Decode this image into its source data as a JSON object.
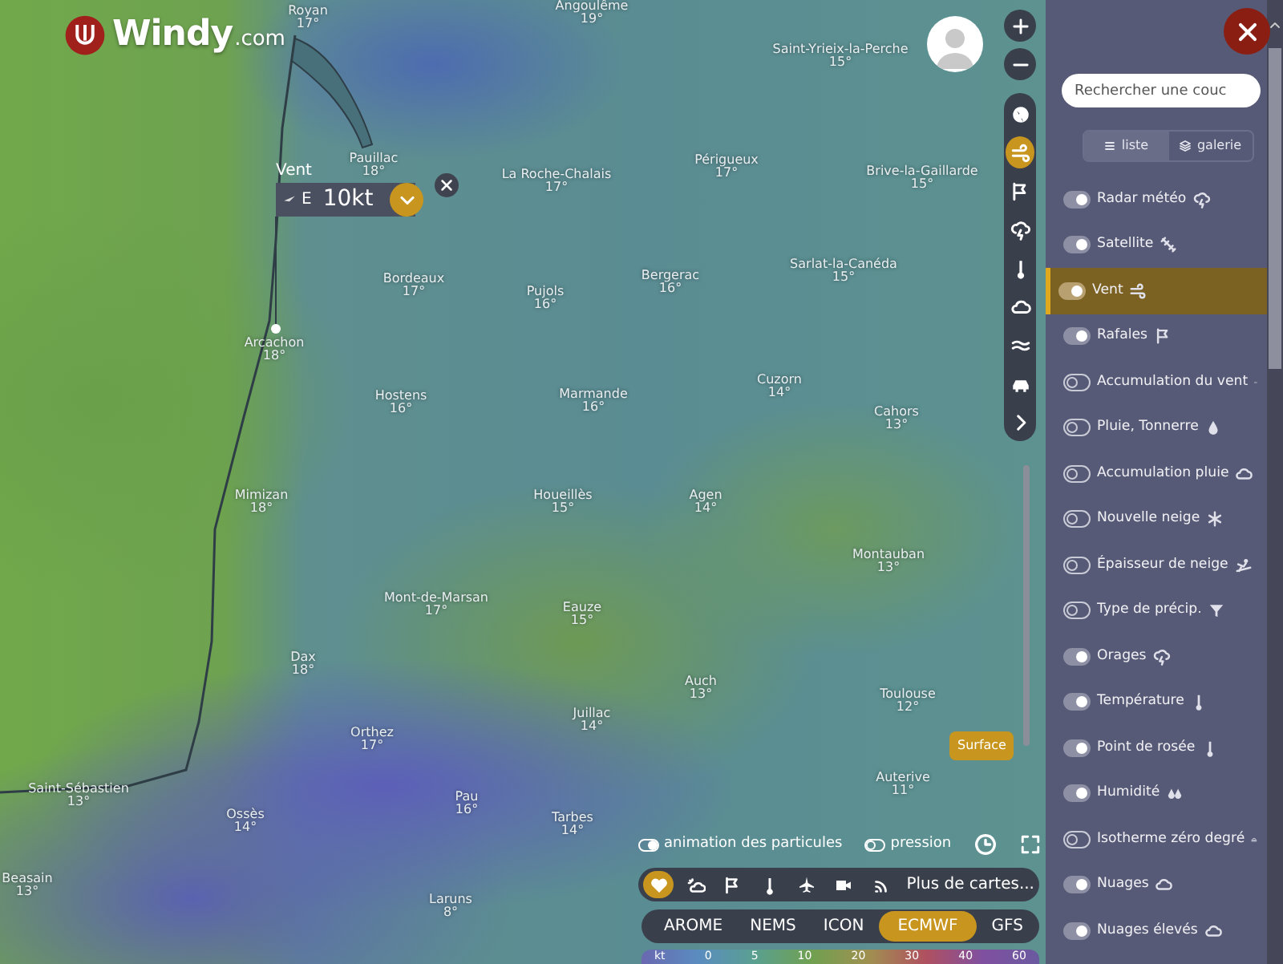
{
  "logo": {
    "name": "Windy",
    "suffix": ".com"
  },
  "map": {
    "cities": [
      {
        "name": "Royan",
        "temp": "17°"
      },
      {
        "name": "Angoulême",
        "temp": "19°"
      },
      {
        "name": "Saint-Yrieix-la-Perche",
        "temp": "15°"
      },
      {
        "name": "Pauillac",
        "temp": "18°"
      },
      {
        "name": "La Roche-Chalais",
        "temp": "17°"
      },
      {
        "name": "Périgueux",
        "temp": "17°"
      },
      {
        "name": "Brive-la-Gaillarde",
        "temp": "15°"
      },
      {
        "name": "Bordeaux",
        "temp": "17°"
      },
      {
        "name": "Pujols",
        "temp": "16°"
      },
      {
        "name": "Bergerac",
        "temp": "16°"
      },
      {
        "name": "Sarlat-la-Canéda",
        "temp": "15°"
      },
      {
        "name": "Arcachon",
        "temp": "18°"
      },
      {
        "name": "Hostens",
        "temp": "16°"
      },
      {
        "name": "Marmande",
        "temp": "16°"
      },
      {
        "name": "Cuzorn",
        "temp": "14°"
      },
      {
        "name": "Cahors",
        "temp": "13°"
      },
      {
        "name": "Mimizan",
        "temp": "18°"
      },
      {
        "name": "Houeillès",
        "temp": "15°"
      },
      {
        "name": "Agen",
        "temp": "14°"
      },
      {
        "name": "Montauban",
        "temp": "13°"
      },
      {
        "name": "Mont-de-Marsan",
        "temp": "17°"
      },
      {
        "name": "Eauze",
        "temp": "15°"
      },
      {
        "name": "Dax",
        "temp": "18°"
      },
      {
        "name": "Auch",
        "temp": "13°"
      },
      {
        "name": "Toulouse",
        "temp": "12°"
      },
      {
        "name": "Juillac",
        "temp": "14°"
      },
      {
        "name": "Orthez",
        "temp": "17°"
      },
      {
        "name": "Auterive",
        "temp": "11°"
      },
      {
        "name": "Saint-Sébastien",
        "temp": "13°"
      },
      {
        "name": "Ossès",
        "temp": "14°"
      },
      {
        "name": "Pau",
        "temp": "16°"
      },
      {
        "name": "Tarbes",
        "temp": "14°"
      },
      {
        "name": "Beasain",
        "temp": "13°"
      },
      {
        "name": "Laruns",
        "temp": "8°"
      }
    ]
  },
  "wind_popup": {
    "label": "Vent",
    "direction": "E",
    "value": "10kt"
  },
  "layer_toolbar": [
    {
      "selected": false
    },
    {
      "selected": true
    },
    {
      "selected": false
    },
    {
      "selected": false
    },
    {
      "selected": false
    },
    {
      "selected": false
    },
    {
      "selected": false
    },
    {
      "selected": false
    },
    {
      "selected": false
    }
  ],
  "altitude": {
    "label": "Surface",
    "level": 0
  },
  "overlays": [
    {
      "label": "animation des particules",
      "on": true
    },
    {
      "label": "pression",
      "on": false
    }
  ],
  "quick_maps": {
    "items": [
      {
        "selected": true
      },
      {
        "selected": false
      },
      {
        "selected": false
      },
      {
        "selected": false
      },
      {
        "selected": false
      },
      {
        "selected": false
      },
      {
        "selected": false
      }
    ],
    "more": "Plus de cartes..."
  },
  "models": [
    {
      "label": "AROME",
      "selected": false
    },
    {
      "label": "NEMS",
      "selected": false
    },
    {
      "label": "ICON",
      "selected": false
    },
    {
      "label": "ECMWF",
      "selected": true
    },
    {
      "label": "GFS",
      "selected": false
    }
  ],
  "legend": {
    "unit": "kt",
    "ticks": [
      "0",
      "5",
      "10",
      "20",
      "30",
      "40",
      "60"
    ]
  },
  "panel": {
    "search": {
      "placeholder": "Rechercher une couc"
    },
    "view_tabs": [
      {
        "label": "liste",
        "selected": true
      },
      {
        "label": "galerie",
        "selected": false
      }
    ],
    "layers": [
      {
        "label": "Radar météo",
        "on": true,
        "selected": false
      },
      {
        "label": "Satellite",
        "on": true,
        "selected": false
      },
      {
        "label": "Vent",
        "on": true,
        "selected": true
      },
      {
        "label": "Rafales",
        "on": true,
        "selected": false
      },
      {
        "label": "Accumulation du vent",
        "on": false,
        "selected": false
      },
      {
        "label": "Pluie, Tonnerre",
        "on": false,
        "selected": false
      },
      {
        "label": "Accumulation pluie",
        "on": false,
        "selected": false
      },
      {
        "label": "Nouvelle neige",
        "on": false,
        "selected": false
      },
      {
        "label": "Épaisseur de neige",
        "on": false,
        "selected": false
      },
      {
        "label": "Type de précip.",
        "on": false,
        "selected": false
      },
      {
        "label": "Orages",
        "on": true,
        "selected": false
      },
      {
        "label": "Température",
        "on": true,
        "selected": false
      },
      {
        "label": "Point de rosée",
        "on": true,
        "selected": false
      },
      {
        "label": "Humidité",
        "on": true,
        "selected": false
      },
      {
        "label": "Isotherme zéro degré",
        "on": false,
        "selected": false
      },
      {
        "label": "Nuages",
        "on": true,
        "selected": false
      },
      {
        "label": "Nuages élevés",
        "on": true,
        "selected": false
      }
    ]
  }
}
